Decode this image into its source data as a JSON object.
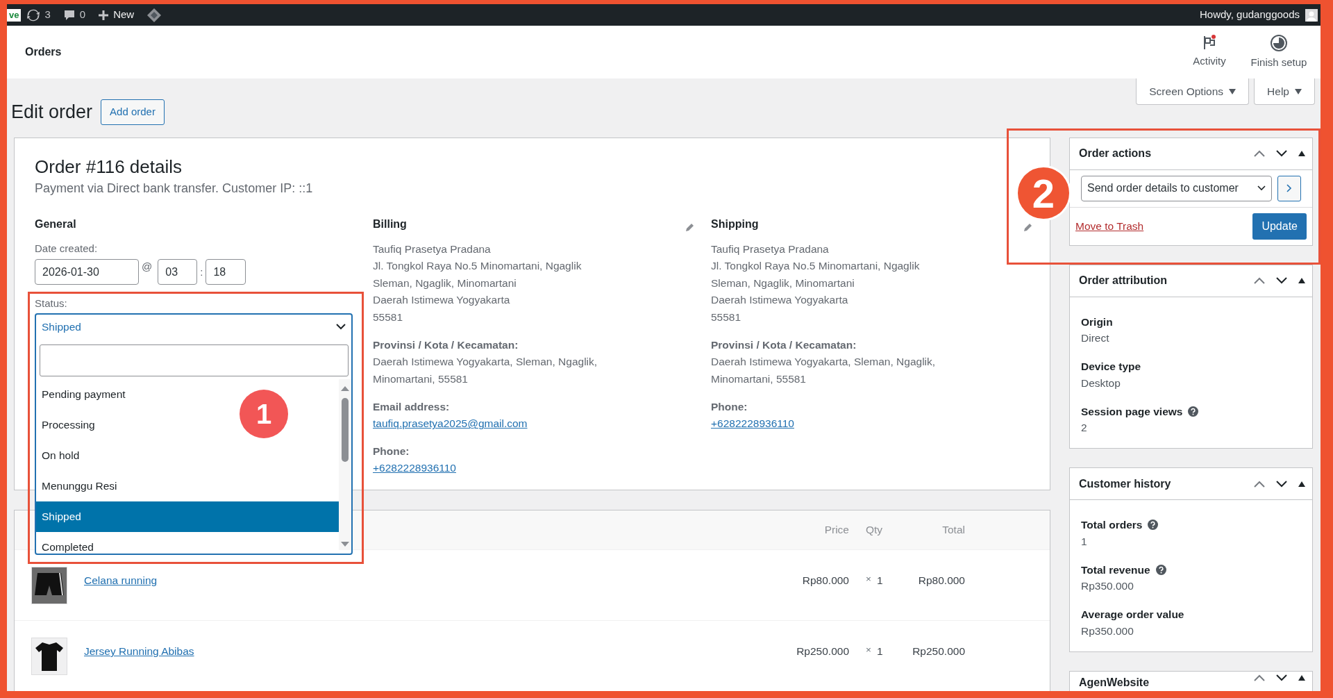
{
  "admin_bar": {
    "logo": "ve",
    "updates": "3",
    "comments": "0",
    "new": "New",
    "greeting": "Howdy, gudanggoods"
  },
  "header": {
    "title": "Orders",
    "actions": [
      {
        "label": "Activity",
        "kind": "activity"
      },
      {
        "label": "Finish setup",
        "kind": "setup"
      }
    ]
  },
  "screen_tabs": [
    "Screen Options",
    "Help"
  ],
  "page": {
    "title": "Edit order",
    "add_button": "Add order"
  },
  "order": {
    "title": "Order #116 details",
    "subtitle": "Payment via Direct bank transfer. Customer IP: ::1",
    "general": {
      "heading": "General",
      "date_label": "Date created:",
      "date": "2026-01-30",
      "at": "@",
      "hour": "03",
      "colon": ":",
      "minute": "18",
      "status_label": "Status:"
    },
    "columns": [
      {
        "heading": "Billing",
        "address": [
          "Taufiq Prasetya Pradana",
          "Jl. Tongkol Raya No.5 Minomartani, Ngaglik",
          "Sleman, Ngaglik, Minomartani",
          "Daerah Istimewa Yogyakarta",
          "55581"
        ],
        "fields": [
          {
            "label": "Provinsi / Kota / Kecamatan:",
            "value": "Daerah Istimewa Yogyakarta, Sleman, Ngaglik, Minomartani, 55581",
            "kind": "text"
          },
          {
            "label": "Email address:",
            "value": "taufiq.prasetya2025@gmail.com",
            "kind": "link"
          },
          {
            "label": "Phone:",
            "value": "+6282228936110",
            "kind": "link"
          }
        ]
      },
      {
        "heading": "Shipping",
        "address": [
          "Taufiq Prasetya Pradana",
          "Jl. Tongkol Raya No.5 Minomartani, Ngaglik",
          "Sleman, Ngaglik, Minomartani",
          "Daerah Istimewa Yogyakarta",
          "55581"
        ],
        "fields": [
          {
            "label": "Provinsi / Kota / Kecamatan:",
            "value": "Daerah Istimewa Yogyakarta, Sleman, Ngaglik, Minomartani, 55581",
            "kind": "text"
          },
          {
            "label": "Phone:",
            "value": "+6282228936110",
            "kind": "link"
          }
        ]
      }
    ]
  },
  "status_dropdown": {
    "value": "Shipped",
    "options": [
      {
        "label": "Pending payment",
        "selected": false
      },
      {
        "label": "Processing",
        "selected": false
      },
      {
        "label": "On hold",
        "selected": false
      },
      {
        "label": "Menunggu Resi",
        "selected": false
      },
      {
        "label": "Shipped",
        "selected": true
      },
      {
        "label": "Completed",
        "selected": false
      }
    ]
  },
  "items": {
    "columns": [
      "Price",
      "Qty",
      "Total"
    ],
    "rows": [
      {
        "name": "Celana running",
        "kind": "shorts",
        "price": "Rp80.000",
        "times": "×",
        "qty": "1",
        "total": "Rp80.000"
      },
      {
        "name": "Jersey Running Abibas",
        "kind": "shirt",
        "price": "Rp250.000",
        "times": "×",
        "qty": "1",
        "total": "Rp250.000"
      }
    ]
  },
  "sidebar": [
    {
      "title": "Order actions",
      "kind": "actions",
      "action": "Send order details to customer",
      "trash": "Move to Trash",
      "button": "Update"
    },
    {
      "title": "Order attribution",
      "kind": "fields",
      "fields": [
        {
          "label": "Origin",
          "value": "Direct",
          "help": false
        },
        {
          "label": "Device type",
          "value": "Desktop",
          "help": false
        },
        {
          "label": "Session page views",
          "value": "2",
          "help": true
        }
      ]
    },
    {
      "title": "Customer history",
      "kind": "fields",
      "fields": [
        {
          "label": "Total orders",
          "value": "1",
          "help": true
        },
        {
          "label": "Total revenue",
          "value": "Rp350.000",
          "help": true
        },
        {
          "label": "Average order value",
          "value": "Rp350.000",
          "help": false
        }
      ]
    },
    {
      "title": "AgenWebsite",
      "kind": "stub"
    }
  ],
  "annotations": [
    {
      "label": "1",
      "kind": "plain"
    },
    {
      "label": "2",
      "kind": "outlined"
    }
  ]
}
